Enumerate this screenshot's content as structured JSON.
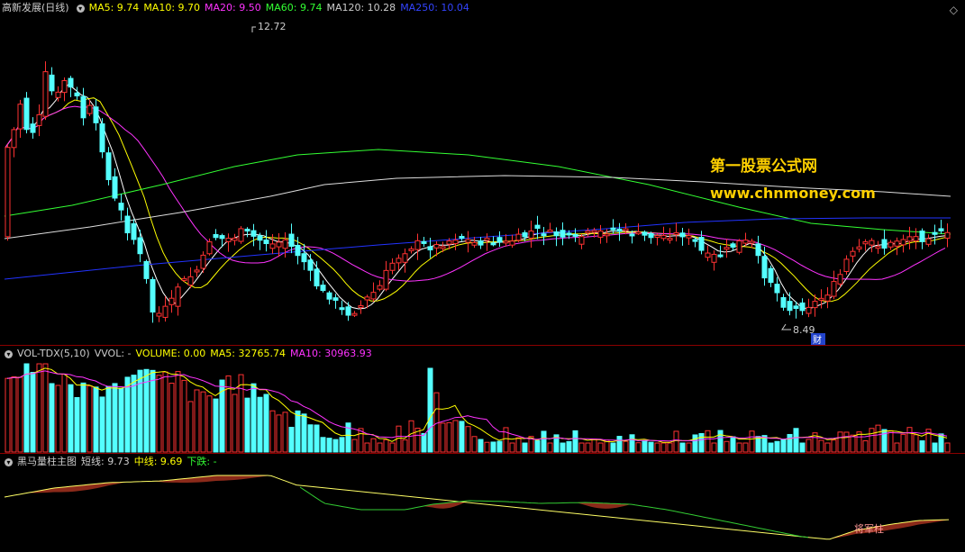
{
  "main": {
    "title": "高新发展(日线)",
    "ma_labels": [
      {
        "text": "MA5: 9.74",
        "color": "#ffff00"
      },
      {
        "text": "MA10: 9.70",
        "color": "#ffff00"
      },
      {
        "text": "MA20: 9.50",
        "color": "#ff33ff"
      },
      {
        "text": "MA60: 9.74",
        "color": "#33ff33"
      },
      {
        "text": "MA120: 10.28",
        "color": "#cccccc"
      },
      {
        "text": "MA250: 10.04",
        "color": "#3344ff"
      }
    ],
    "high_label": "12.72",
    "low_label": "8.49",
    "cai_badge": "财",
    "watermark_title": "第一股票公式网",
    "watermark_url": "www.chnmoney.com"
  },
  "volume": {
    "title": "VOL-TDX(5,10)",
    "labels": [
      {
        "text": "VVOL: -",
        "color": "#cccccc"
      },
      {
        "text": "VOLUME: 0.00",
        "color": "#ffff00"
      },
      {
        "text": "MA5: 32765.74",
        "color": "#ffff00"
      },
      {
        "text": "MA10: 30963.93",
        "color": "#ff33ff"
      }
    ]
  },
  "indicator": {
    "title": "黑马量柱主图",
    "labels": [
      {
        "text": "短线: 9.73",
        "color": "#cccccc"
      },
      {
        "text": "中线: 9.69",
        "color": "#ffff00"
      },
      {
        "text": "下跌: -",
        "color": "#33ff33"
      }
    ],
    "marker": "将军柱"
  },
  "colors": {
    "up": "#ff3232",
    "down": "#54ffff",
    "grid_border": "#8b0000"
  }
}
